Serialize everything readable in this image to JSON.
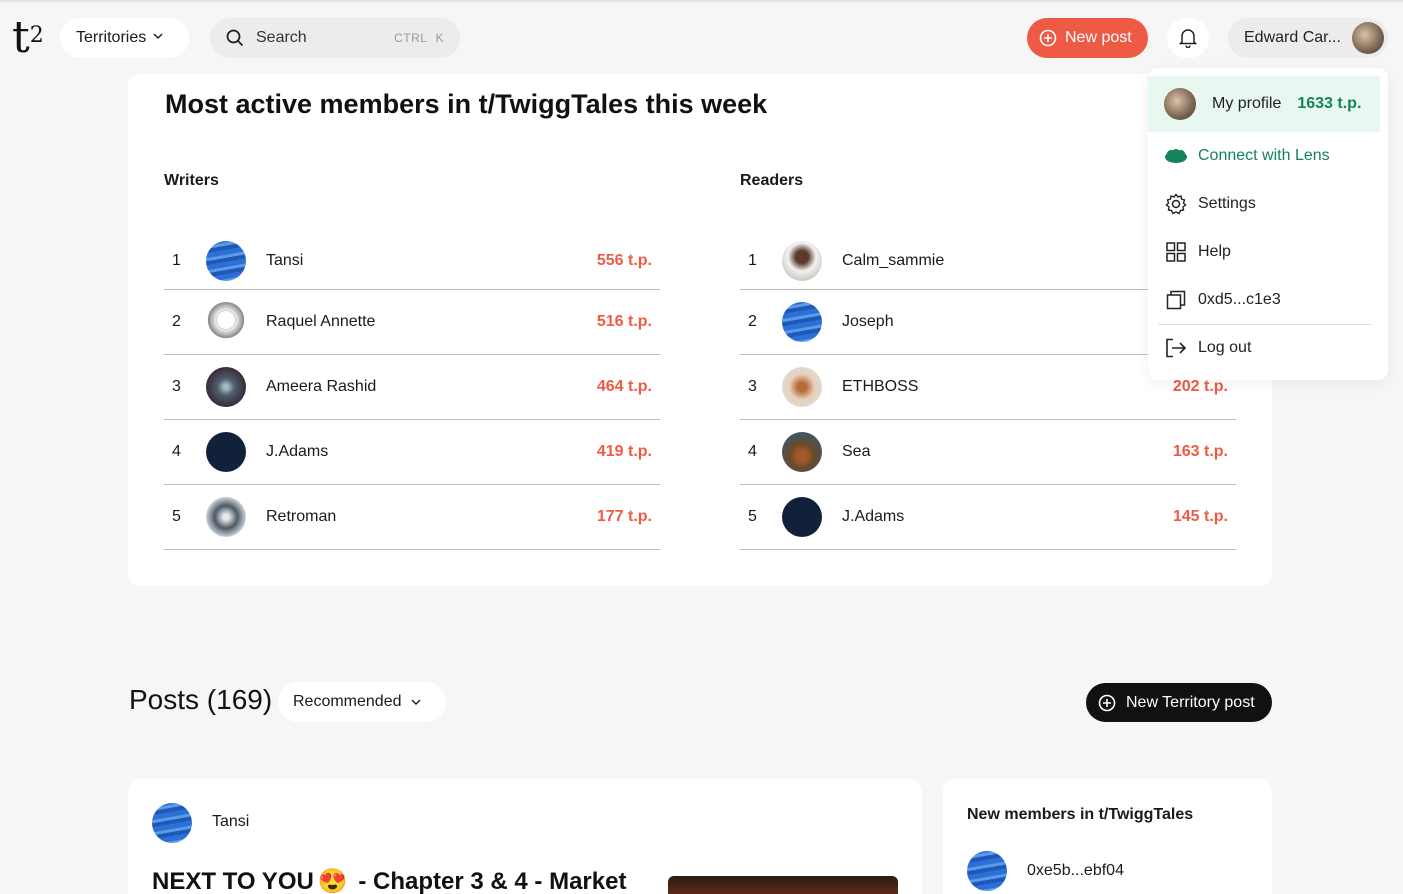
{
  "header": {
    "logo": "t",
    "logo_sup": "2",
    "territories_label": "Territories",
    "search_label": "Search",
    "search_kbd_ctrl": "CTRL",
    "search_kbd_key": "K",
    "new_post_label": "New post",
    "user_name": "Edward Car..."
  },
  "menu": {
    "profile_label": "My profile",
    "profile_points": "1633 t.p.",
    "lens_label": "Connect with Lens",
    "settings_label": "Settings",
    "help_label": "Help",
    "wallet_label": "0xd5...c1e3",
    "logout_label": "Log out"
  },
  "active": {
    "title": "Most active members in t/TwiggTales this week",
    "writers_heading": "Writers",
    "readers_heading": "Readers",
    "writers": [
      {
        "rank": "1",
        "name": "Tansi",
        "points": "556 t.p."
      },
      {
        "rank": "2",
        "name": "Raquel Annette",
        "points": "516 t.p."
      },
      {
        "rank": "3",
        "name": "Ameera Rashid",
        "points": "464 t.p."
      },
      {
        "rank": "4",
        "name": "J.Adams",
        "points": "419 t.p."
      },
      {
        "rank": "5",
        "name": "Retroman",
        "points": "177 t.p."
      }
    ],
    "readers": [
      {
        "rank": "1",
        "name": "Calm_sammie",
        "points": ""
      },
      {
        "rank": "2",
        "name": "Joseph",
        "points": ""
      },
      {
        "rank": "3",
        "name": "ETHBOSS",
        "points": "202 t.p."
      },
      {
        "rank": "4",
        "name": "Sea",
        "points": "163 t.p."
      },
      {
        "rank": "5",
        "name": "J.Adams",
        "points": "145 t.p."
      }
    ]
  },
  "posts": {
    "title": "Posts (169)",
    "sort_label": "Recommended",
    "new_territory_post_label": "New Territory post",
    "first_post": {
      "author": "Tansi",
      "title_before": "NEXT TO YOU",
      "emoji": "😍",
      "title_after": " - Chapter 3 & 4 - Market"
    }
  },
  "new_members": {
    "title": "New members in t/TwiggTales",
    "first_member": "0xe5b...ebf04"
  },
  "colors": {
    "accent_red": "#ef5a45",
    "accent_green": "#14835a"
  }
}
